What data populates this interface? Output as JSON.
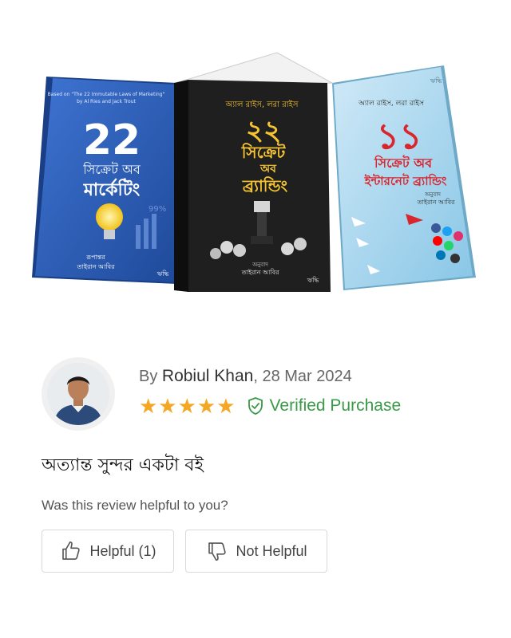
{
  "books": [
    {
      "top_text": "Based on \"The 22 Immutable Laws of Marketing\"",
      "top_text2": "by Al Ries and Jack Trout",
      "number": "22",
      "title_line1": "সিক্রেট অব",
      "title_line2": "মার্কেটিং",
      "percent": "99%",
      "translator_label": "রূপান্তর",
      "translator": "তাইরান আবির",
      "publisher": "ঋদ্ধি"
    },
    {
      "authors": "অ্যাল রাইস, লরা রাইস",
      "number": "২২",
      "title_line1": "সিক্রেট",
      "title_line2": "অব",
      "title_line3": "ব্র্যান্ডিং",
      "translator_label": "অনুবাদ",
      "translator": "তাইরান আবির",
      "publisher": "ঋদ্ধি"
    },
    {
      "corner": "ঋদ্ধি",
      "authors": "অ্যাল রাইস, লরা রাইস",
      "number": "১১",
      "title_line1": "সিক্রেট অব",
      "title_line2": "ইন্টারনেট ব্র্যান্ডিং",
      "translator_label": "অনুবাদ",
      "translator": "তাইরান আবির"
    }
  ],
  "review": {
    "by_prefix": "By ",
    "reviewer": "Robiul Khan",
    "date": ", 28 Mar 2024",
    "rating": 5,
    "stars": "★★★★★",
    "verified_label": "Verified Purchase",
    "text": "অত্যান্ত সুন্দর একটা বই",
    "question": "Was this review helpful to you?",
    "helpful_label": "Helpful (1)",
    "not_helpful_label": "Not Helpful"
  },
  "colors": {
    "star": "#f5a623",
    "verified": "#3a9a47",
    "book1": "#2f5fb8",
    "book2": "#1f1f1f",
    "book3": "#a8d6ee"
  },
  "icons": [
    "check-shield-icon",
    "thumbs-up-icon",
    "thumbs-down-icon"
  ]
}
